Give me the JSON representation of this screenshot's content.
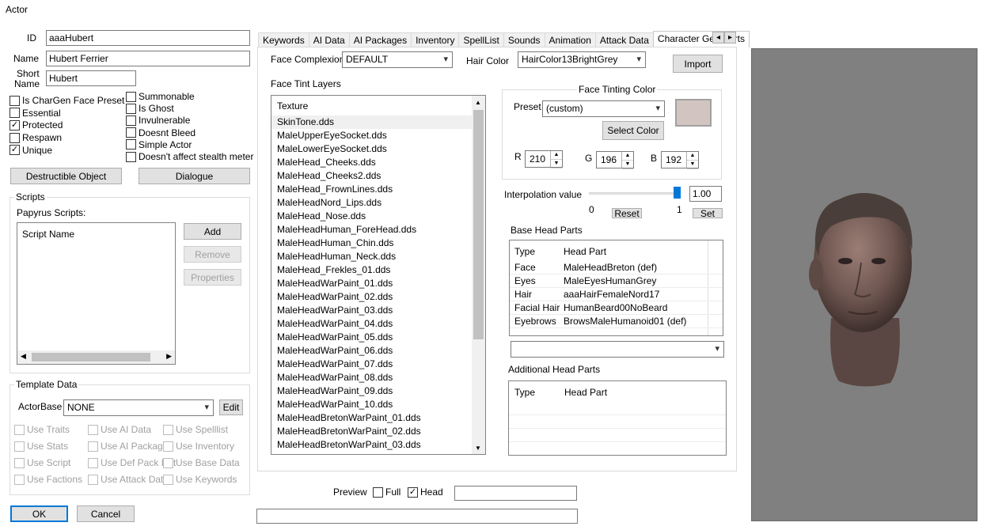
{
  "window": {
    "title": "Actor"
  },
  "fields": {
    "id_label": "ID",
    "id_value": "aaaHubert",
    "name_label": "Name",
    "name_value": "Hubert Ferrier",
    "short_name_label_1": "Short",
    "short_name_label_2": "Name",
    "short_name_value": "Hubert"
  },
  "flags_left": [
    {
      "label": "Is CharGen Face Preset",
      "checked": false
    },
    {
      "label": "Essential",
      "checked": false
    },
    {
      "label": "Protected",
      "checked": true
    },
    {
      "label": "Respawn",
      "checked": false
    },
    {
      "label": "Unique",
      "checked": true
    }
  ],
  "flags_right": [
    {
      "label": "Summonable",
      "checked": false
    },
    {
      "label": "Is Ghost",
      "checked": false
    },
    {
      "label": "Invulnerable",
      "checked": false
    },
    {
      "label": "Doesnt Bleed",
      "checked": false
    },
    {
      "label": "Simple Actor",
      "checked": false
    },
    {
      "label": "Doesn't affect stealth meter",
      "checked": false
    }
  ],
  "buttons": {
    "destructible": "Destructible Object",
    "dialogue": "Dialogue",
    "add": "Add",
    "remove": "Remove",
    "properties": "Properties",
    "edit": "Edit",
    "ok": "OK",
    "cancel": "Cancel",
    "import": "Import",
    "select_color": "Select Color",
    "reset": "Reset",
    "set": "Set"
  },
  "scripts": {
    "group_title": "Scripts",
    "papyrus_label": "Papyrus Scripts:",
    "column": "Script Name"
  },
  "template": {
    "group_title": "Template Data",
    "actorbase_label": "ActorBase",
    "actorbase_value": "NONE",
    "options": [
      [
        "Use Traits",
        "Use AI Data",
        "Use Spelllist"
      ],
      [
        "Use Stats",
        "Use AI Packages",
        "Use Inventory"
      ],
      [
        "Use Script",
        "Use Def Pack List",
        "Use Base Data"
      ],
      [
        "Use Factions",
        "Use Attack Data",
        "Use Keywords"
      ]
    ]
  },
  "tabs": [
    "Keywords",
    "AI Data",
    "AI Packages",
    "Inventory",
    "SpellList",
    "Sounds",
    "Animation",
    "Attack Data",
    "Character Gen Parts"
  ],
  "tab_scroll": {
    "left": "◂",
    "right": "▸"
  },
  "chargen": {
    "face_complexion_label": "Face Complexion",
    "face_complexion_value": "DEFAULT",
    "hair_color_label": "Hair Color",
    "hair_color_value": "HairColor13BrightGrey",
    "face_tint_layers_label": "Face Tint Layers",
    "texture_header": "Texture",
    "textures": [
      "SkinTone.dds",
      "MaleUpperEyeSocket.dds",
      "MaleLowerEyeSocket.dds",
      "MaleHead_Cheeks.dds",
      "MaleHead_Cheeks2.dds",
      "MaleHead_FrownLines.dds",
      "MaleHeadNord_Lips.dds",
      "MaleHead_Nose.dds",
      "MaleHeadHuman_ForeHead.dds",
      "MaleHeadHuman_Chin.dds",
      "MaleHeadHuman_Neck.dds",
      "MaleHead_Frekles_01.dds",
      "MaleHeadWarPaint_01.dds",
      "MaleHeadWarPaint_02.dds",
      "MaleHeadWarPaint_03.dds",
      "MaleHeadWarPaint_04.dds",
      "MaleHeadWarPaint_05.dds",
      "MaleHeadWarPaint_06.dds",
      "MaleHeadWarPaint_07.dds",
      "MaleHeadWarPaint_08.dds",
      "MaleHeadWarPaint_09.dds",
      "MaleHeadWarPaint_10.dds",
      "MaleHeadBretonWarPaint_01.dds",
      "MaleHeadBretonWarPaint_02.dds",
      "MaleHeadBretonWarPaint_03.dds"
    ],
    "tint_group_title": "Face Tinting Color",
    "preset_label": "Preset",
    "preset_value": "(custom)",
    "swatch_color": "#d2c4c0",
    "r_label": "R",
    "r_value": "210",
    "g_label": "G",
    "g_value": "196",
    "b_label": "B",
    "b_value": "192",
    "interp_label": "Interpolation value",
    "interp_value": "1.00",
    "interp_fraction": 1.0,
    "slider_min": "0",
    "slider_max": "1",
    "base_head_parts_label": "Base Head Parts",
    "head_cols": [
      "Type",
      "Head Part"
    ],
    "head_parts": [
      [
        "Face",
        "MaleHeadBreton (def)"
      ],
      [
        "Eyes",
        "MaleEyesHumanGrey"
      ],
      [
        "Hair",
        "aaaHairFemaleNord17"
      ],
      [
        "Facial Hair",
        "HumanBeard00NoBeard"
      ],
      [
        "Eyebrows",
        "BrowsMaleHumanoid01 (def)"
      ]
    ],
    "additional_head_parts_label": "Additional Head Parts",
    "additional_cols": [
      "Type",
      "Head Part"
    ]
  },
  "preview": {
    "label": "Preview",
    "full_label": "Full",
    "full_checked": false,
    "head_label": "Head",
    "head_checked": true
  },
  "colors": {
    "preview_bg": "#808080",
    "accent": "#0078d7"
  },
  "icons": {
    "dropdown": "▾",
    "check": "✓",
    "up": "▲",
    "down": "▼",
    "left": "◀",
    "right": "▶"
  }
}
